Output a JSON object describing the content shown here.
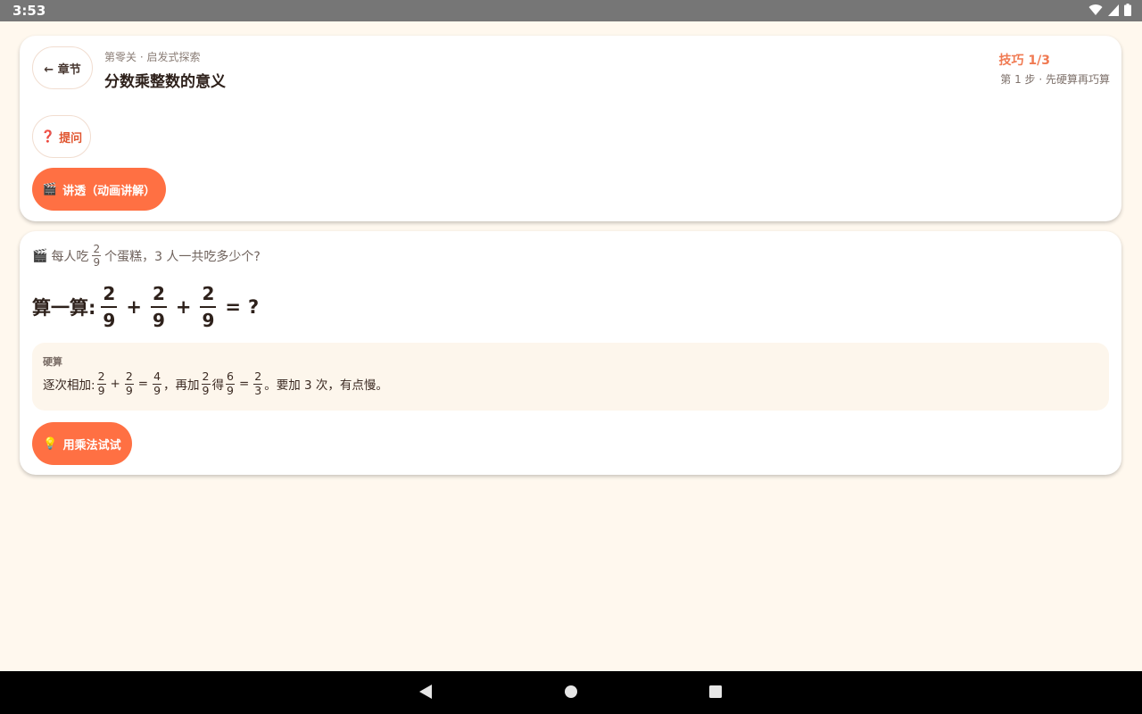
{
  "status_bar": {
    "time": "3:53"
  },
  "header": {
    "back_label": "← 章节",
    "breadcrumb": "第零关 · 启发式探索",
    "title": "分数乘整数的意义",
    "tip_counter": "技巧 1/3",
    "tip_step": "第 1 步 · 先硬算再巧算"
  },
  "actions": {
    "ask_icon": "❓",
    "ask_label": "提问",
    "explain_icon": "🎬",
    "explain_label": "讲透（动画讲解）"
  },
  "problem": {
    "icon": "🎬",
    "text_before": "每人吃",
    "fraction": {
      "num": "2",
      "den": "9"
    },
    "text_after": "个蛋糕，3 人一共吃多少个?",
    "equation_label": "算一算:",
    "equation_terms": [
      {
        "num": "2",
        "den": "9"
      },
      {
        "num": "2",
        "den": "9"
      },
      {
        "num": "2",
        "den": "9"
      }
    ],
    "plus_sign": "+",
    "equals_sign": "=",
    "unknown": "?"
  },
  "hint": {
    "title": "硬算",
    "prefix": "逐次相加:",
    "parts": {
      "a": {
        "num": "2",
        "den": "9"
      },
      "b": {
        "num": "2",
        "den": "9"
      },
      "sum": {
        "num": "4",
        "den": "9"
      },
      "text_again": "，再加",
      "c": {
        "num": "2",
        "den": "9"
      },
      "text_get": "得",
      "total": {
        "num": "6",
        "den": "9"
      },
      "simplified": {
        "num": "2",
        "den": "3"
      },
      "tail": "。要加 3 次，有点慢。"
    },
    "plus_sign": "+",
    "equals_sign": "="
  },
  "try_button": {
    "icon": "💡",
    "label": "用乘法试试"
  },
  "colors": {
    "accent": "#ff7043",
    "background": "#fff8ee",
    "card": "#ffffff",
    "hint_bg": "#fdf6ec"
  },
  "icons": {
    "wifi": "wifi-icon",
    "signal": "signal-icon",
    "battery": "battery-icon",
    "back": "nav-back-icon",
    "home": "nav-home-icon",
    "recents": "nav-recents-icon"
  }
}
